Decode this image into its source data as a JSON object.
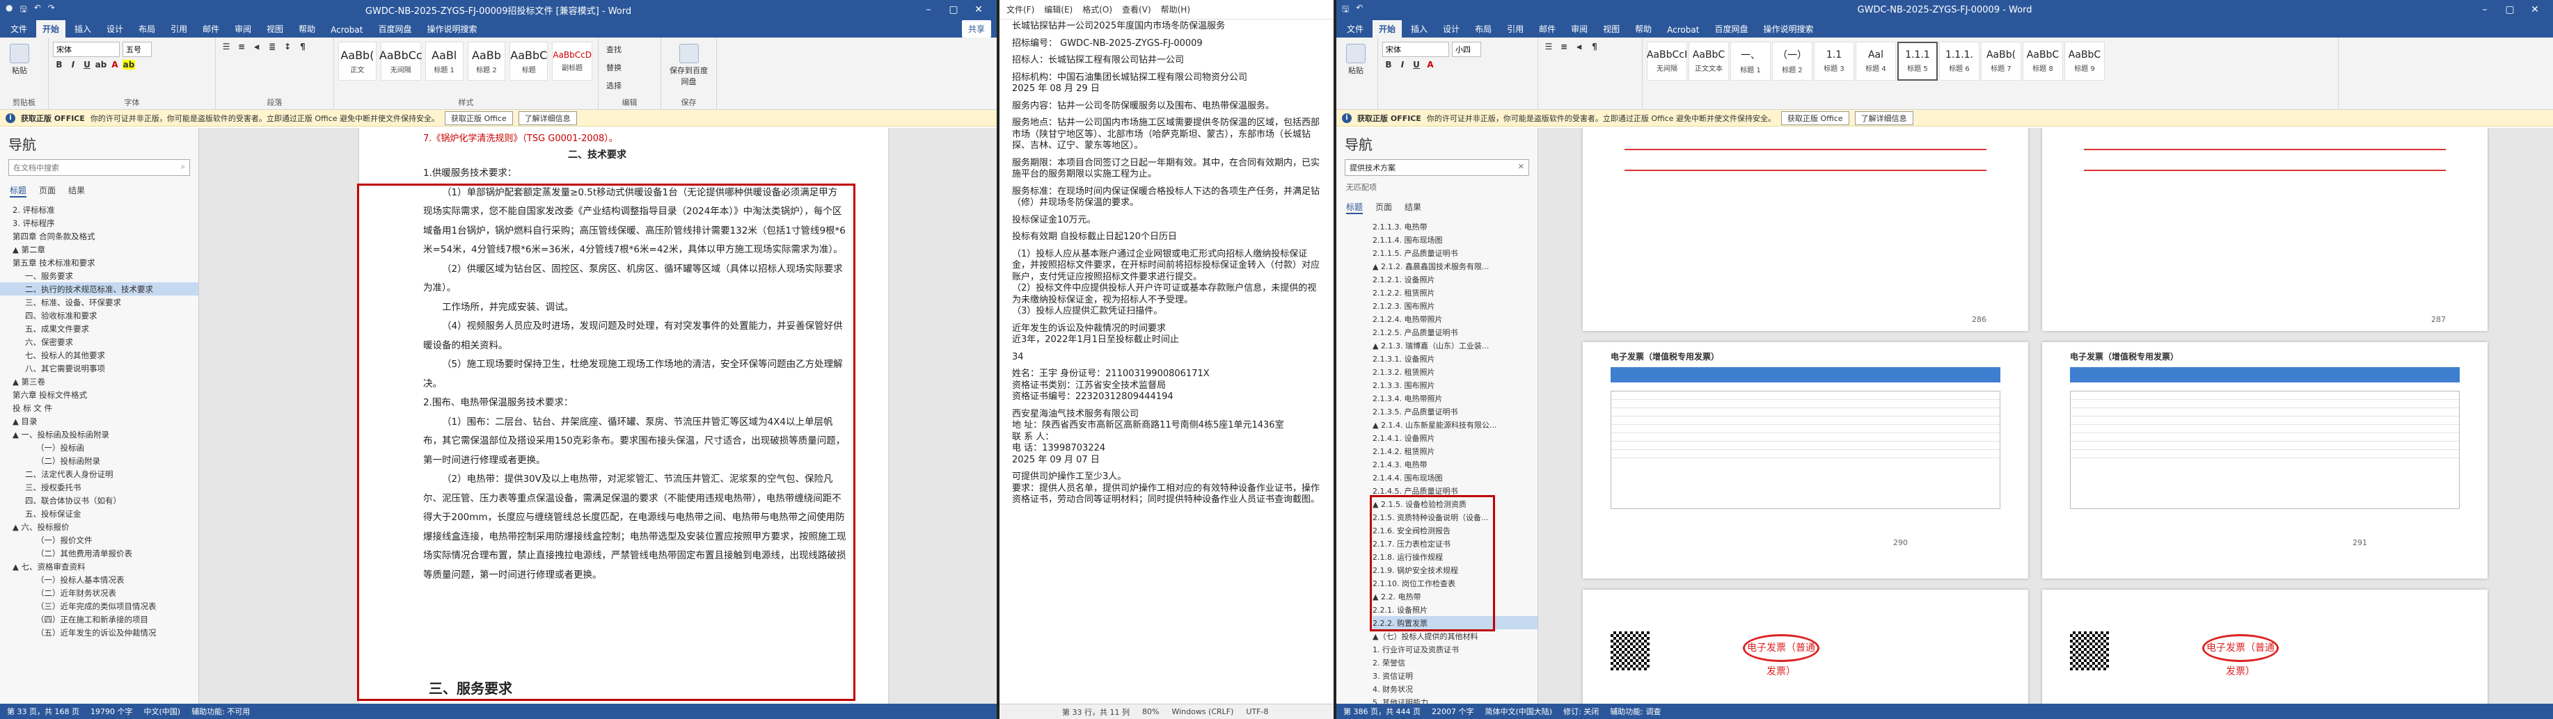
{
  "left_window": {
    "title": "GWDC-NB-2025-ZYGS-FJ-00009招投标文件 [兼容模式] - Word",
    "tabs": [
      "文件",
      "开始",
      "插入",
      "设计",
      "布局",
      "引用",
      "邮件",
      "审阅",
      "视图",
      "帮助",
      "Acrobat",
      "百度网盘",
      "操作说明搜索"
    ],
    "active_tab": "开始",
    "share": "共享",
    "font_name": "宋体",
    "font_size": "五号",
    "groups": [
      "剪贴板",
      "字体",
      "段落",
      "样式",
      "编辑",
      "保存"
    ],
    "styles": [
      {
        "sample": "AaBb(",
        "name": "正文"
      },
      {
        "sample": "AaBbCc",
        "name": "无间隔"
      },
      {
        "sample": "AaBl",
        "name": "标题 1"
      },
      {
        "sample": "AaBb",
        "name": "标题 2"
      },
      {
        "sample": "AaBbC",
        "name": "标题"
      },
      {
        "sample": "AaBbCcD",
        "name": "副标题"
      }
    ],
    "edit_items": [
      "查找",
      "替换",
      "选择"
    ],
    "save_label": "保存到百度网盘",
    "infobar": {
      "badge": "获取正版 OFFICE",
      "text": "你的许可证并非正版，你可能是盗版软件的受害者。立即通过正版 Office 避免中断并使文件保持安全。",
      "btn1": "获取正版 Office",
      "btn2": "了解详细信息"
    },
    "nav": {
      "title": "导航",
      "search_placeholder": "在文档中搜索",
      "tabs": [
        "标题",
        "页面",
        "结果"
      ],
      "items": [
        "2. 评标标准",
        "3. 评标程序",
        "第四章 合同条款及格式",
        "▲ 第二章",
        "第五章  技术标准和要求",
        "一、服务要求",
        "二、执行的技术规范标准、技术要求",
        "三、标准、设备、环保要求",
        "四、验收标准和要求",
        "五、成果文件要求",
        "六、保密要求",
        "七、投标人的其他要求",
        "八、其它需要说明事项",
        "▲ 第三卷",
        "第六章  投标文件格式",
        "投 标 文 件",
        "▲ 目录",
        "▲ 一、投标函及投标函附录",
        "（一）投标函",
        "（二）投标函附录",
        "二、法定代表人身份证明",
        "三、授权委托书",
        "四、联合体协议书（如有）",
        "五、投标保证金",
        "▲ 六、投标报价",
        "（一）报价文件",
        "（二）其他费用清单报价表",
        "▲ 七、资格审查资料",
        "（一）投标人基本情况表",
        "（二）近年财务状况表",
        "（三）近年完成的类似项目情况表",
        "（四）正在施工和新承接的项目",
        "（五）近年发生的诉讼及仲裁情况"
      ]
    },
    "doc": {
      "top_red": "7.《锅炉化学清洗规则》（TSG G0001-2008）。",
      "heading": "二、技术要求",
      "paragraphs": [
        "1.供暖服务技术要求：",
        "（1）单部锅炉配套额定蒸发量≥0.5t移动式供暖设备1台（无论提供哪种供暖设备必须满足甲方现场实际需求，您不能自国家发改委《产业结构调整指导目录（2024年本）》中淘汰类锅炉），每个区域备用1台锅炉，锅炉燃料自行采购；高压管线保暖、高压阶管线排计需要132米（包括1寸管线9根*6米=54米，4分管线7根*6米=36米，4分管线7根*6米=42米，具体以甲方施工现场实际需求为准）。",
        "（2）供暖区域为钻台区、固控区、泵房区、机房区、循环罐等区域（具体以招标人现场实际要求为准）。",
        "工作场所，并完成安装、调试。",
        "（4）视频服务人员应及时进场，发现问题及时处理，有对突发事件的处置能力，并妥善保管好供暖设备的相关资料。",
        "（5）施工现场要时保持卫生，杜绝发现施工现场工作场地的清洁，安全环保等问题由乙方处理解决。",
        "2.围布、电热带保温服务技术要求：",
        "（1）围布：二层台、钻台、井架底座、循环罐、泵房、节流压井管汇等区域为4X4以上单层帆布，其它需保温部位及搭设采用150克彩条布。要求围布接头保温，尺寸适合，出现破损等质量问题，第一时间进行修理或者更换。",
        "（2）电热带：提供30V及以上电热带，对泥浆管汇、节流压井管汇、泥浆泵的空气包、保险凡尔、泥压管、压力表等重点保温设备，需满足保温的要求（不能使用违规电热带），电热带缠绕间距不得大于200mm，长度应与缠绕管线总长度匹配，在电源线与电热带之间、电热带与电热带之间使用防爆接线盒连接，电热带控制采用防爆接线盒控制；电热带选型及安装位置应按照甲方要求，按照施工现场实际情况合理布置，禁止直接拽拉电源线，严禁管线电热带固定布置且接触到电源线，出现线路破损等质量问题，第一时间进行修理或者更换。"
      ],
      "bottom_heading": "三、服务要求",
      "status": [
        "第 33 页，共 168 页",
        "19790 个字",
        "中文(中国)",
        "辅助功能: 不可用"
      ]
    }
  },
  "middle_window": {
    "lines": [
      "长城钻探钻井一公司2025年度国内市场冬防保温服务",
      "",
      "招标编号：  GWDC-NB-2025-ZYGS-FJ-00009",
      "",
      "招标人：长城钻探工程有限公司钻井一公司",
      "",
      "招标机构：中国石油集团长城钻探工程有限公司物资分公司",
      "2025 年 08 月 29 日",
      "",
      "服务内容：钻井一公司冬防保暖服务以及围布、电热带保温服务。",
      "",
      "服务地点：钻井一公司国内市场施工区域需要提供冬防保温的区域，包括西部市场（陕甘宁地区等）、北部市场（哈萨克斯坦、蒙古），东部市场（长城钻探、吉林、辽宁、蒙东等地区）。",
      "",
      "服务期限：本项目合同签订之日起一年期有效。其中，在合同有效期内，已实施平台的服务期限以实施工程为止。",
      "",
      "服务标准：在现场时间内保证保暖合格投标人下达的各项生产任务，并满足钻（修）井现场冬防保温的要求。",
      "",
      "投标保证金10万元。",
      "",
      "投标有效期          自投标截止日起120个日历日",
      "",
      "（1）投标人应从基本账户通过企业网银或电汇形式向招标人缴纳投标保证金，并按照招标文件要求，在开标时间前将招标投标保证金转入（付款）对应账户，支付凭证应按照招标文件要求进行提交。",
      "（2）投标文件中应提供投标人开户许可证或基本存款账户信息，未提供的视为未缴纳投标保证金，视为招标人不予受理。",
      "（3）投标人应提供汇款凭证扫描件。",
      "",
      "近年发生的诉讼及仲裁情况的时间要求",
      "近3年，2022年1月1日至投标截止时间止",
      "",
      "34",
      "",
      "姓名：王宇  身份证号：211003199008061​71X",
      "资格证书类别：江苏省安全技术监督局",
      "资格证书编号：22320312​8094441​94",
      "",
      "西安星海油气技术服务有限公司",
      "地     址：陕西省西安市高新区高新商路11号南侧4栋5座1单元1436室",
      "联 系 人：",
      "电     话：13998703224",
      "2025 年 09 月 07 日",
      "",
      "可提供司炉操作工至少3人。",
      "要求：提供人员名单，提供司炉操作工相对应的有效特种设备作业证书，操作资格证书，劳动合同等证明材料；同时提供特种设备作业人员证书查询截图。"
    ],
    "status": [
      "第 33 行，共 11 列",
      "80%",
      "Windows (CRLF)",
      "UTF-8"
    ]
  },
  "right_window": {
    "title": "GWDC-NB-2025-ZYGS-FJ-00009 - Word",
    "tabs": [
      "文件",
      "开始",
      "插入",
      "设计",
      "布局",
      "引用",
      "邮件",
      "审阅",
      "视图",
      "帮助",
      "Acrobat",
      "百度网盘",
      "操作说明搜索"
    ],
    "active_tab": "开始",
    "font_name": "宋体",
    "font_size": "小四",
    "styles": [
      {
        "sample": "AaBbCcI",
        "name": "无间隔"
      },
      {
        "sample": "AaBbC",
        "name": "正文文本"
      },
      {
        "sample": "一、",
        "name": "标题 1"
      },
      {
        "sample": "（一）",
        "name": "标题 2"
      },
      {
        "sample": "1.1",
        "name": "标题 3"
      },
      {
        "sample": "Aal",
        "name": "标题 4"
      },
      {
        "sample": "1.1.1",
        "name": "标题 5"
      },
      {
        "sample": "1.1.1.",
        "name": "标题 6"
      },
      {
        "sample": "AaBb(",
        "name": "标题 7"
      },
      {
        "sample": "AaBbC",
        "name": "标题 8"
      },
      {
        "sample": "AaBbC",
        "name": "标题 9"
      }
    ],
    "infobar": {
      "badge": "获取正版 OFFICE",
      "text": "你的许可证并非正版，你可能是盗版软件的受害者。立即通过正版 Office 避免中断并使文件保持安全。",
      "btn1": "获取正版 Office",
      "btn2": "了解详细信息"
    },
    "nav": {
      "title": "导航",
      "search_value": "提供技术方案",
      "no_match": "无匹配项",
      "tabs": [
        "标题",
        "页面",
        "结果"
      ],
      "items": [
        "2.1.1.3. 电热带",
        "2.1.1.4. 围布现场图",
        "2.1.1.5. 产品质量证明书",
        "▲ 2.1.2. 鑫晨鑫国技术服务有限...",
        "2.1.2.1. 设备照片",
        "2.1.2.2. 租赁照片",
        "2.1.2.3. 围布照片",
        "2.1.2.4. 电热带照片",
        "2.1.2.5. 产品质量证明书",
        "▲ 2.1.3. 瑞博嘉（山东）工业装...",
        "2.1.3.1. 设备照片",
        "2.1.3.2. 租赁照片",
        "2.1.3.3. 围布照片",
        "2.1.3.4. 电热带照片",
        "2.1.3.5. 产品质量证明书",
        "▲ 2.1.4. 山东新星能源科技有限公...",
        "2.1.4.1. 设备照片",
        "2.1.4.2. 租赁照片",
        "2.1.4.3. 电热带",
        "2.1.4.4. 围布现场图",
        "2.1.4.5. 产品质量证明书",
        "▲ 2.1.5. 设备检验检测资质",
        "2.1.5. 资质特种设备说明（设备...",
        "2.1.6. 安全阀检测报告",
        "2.1.7. 压力表检定证书",
        "2.1.8. 运行操作规程",
        "2.1.9. 锅炉安全技术规程",
        "2.1.10. 岗位工作检查表",
        "▲ 2.2. 电热带",
        "2.2.1. 设备照片",
        "2.2.2. 购置发票",
        "▲（七）投标人提供的其他材料",
        "1. 行业许可证及资质证书",
        "2. 荣誉信",
        "3. 资信证明",
        "4. 财务状况",
        "5. 其他证明能力"
      ]
    },
    "invoice_title": "电子发票（增值税专用发票）",
    "invoice_stamp": "电子发票（普通发票）",
    "page_numbers": [
      "286",
      "287",
      "290",
      "291"
    ],
    "status": [
      "第 386 页，共 444 页",
      "22007 个字",
      "简体中文(中国大陆)",
      "修订: 关闭",
      "辅助功能: 调查"
    ]
  },
  "colors": {
    "word_blue": "#2b579a",
    "highlight_red": "#c00000",
    "infobar_yellow": "#fff4ce"
  }
}
